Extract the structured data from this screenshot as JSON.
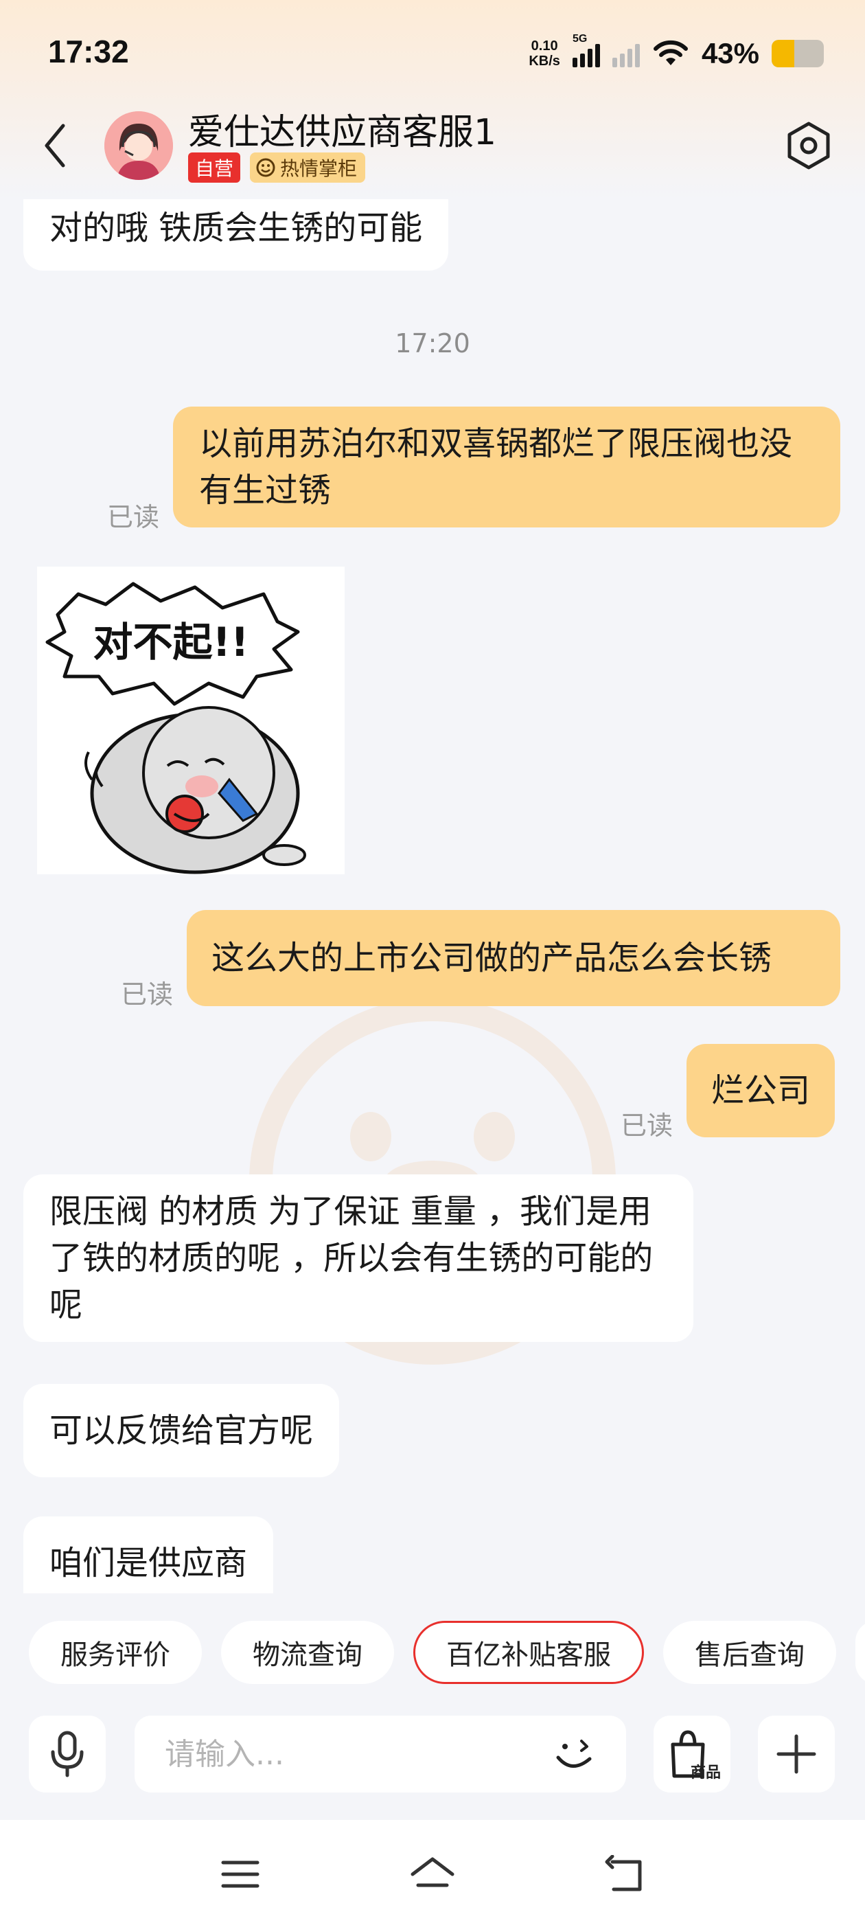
{
  "status_bar": {
    "time": "17:32",
    "net_speed_value": "0.10",
    "net_speed_unit": "KB/s",
    "network_type": "5G",
    "battery_percent": "43%",
    "battery_level": 0.43
  },
  "header": {
    "shop_name": "爱仕达供应商客服1",
    "badge_self_operated": "自营",
    "badge_keeper": "热情掌柜"
  },
  "messages": [
    {
      "side": "in",
      "text": "对的哦 铁质会生锈的可能"
    },
    {
      "type": "timestamp",
      "text": "17:20"
    },
    {
      "side": "out",
      "text": "以前用苏泊尔和双喜锅都烂了限压阀也没有生过锈",
      "read_label": "已读"
    },
    {
      "side": "in",
      "type": "sticker",
      "text": "对不起!!"
    },
    {
      "side": "out",
      "text": "这么大的上市公司做的产品怎么会长锈",
      "read_label": "已读"
    },
    {
      "side": "out",
      "text": "烂公司",
      "read_label": "已读"
    },
    {
      "side": "in",
      "text": "限压阀 的材质 为了保证 重量 ，我们是用了铁的材质的呢 ，所以会有生锈的可能的呢"
    },
    {
      "side": "in",
      "text": "可以反馈给官方呢"
    },
    {
      "side": "in",
      "text": "咱们是供应商"
    }
  ],
  "quick_replies": [
    "服务评价",
    "物流查询",
    "百亿补贴客服",
    "售后查询"
  ],
  "quick_reply_active": "百亿补贴客服",
  "input": {
    "placeholder": "请输入...",
    "goods_label": "商品"
  },
  "icons": {
    "back": "chevron-left-icon",
    "settings": "settings-icon",
    "mic": "mic-icon",
    "emoji": "emoji-icon",
    "goods": "shopping-bag-icon",
    "plus": "plus-icon",
    "menu": "menu-icon",
    "home": "home-icon",
    "back_nav": "back-nav-icon"
  },
  "colors": {
    "outgoing_bubble": "#fdd48a",
    "incoming_bubble": "#ffffff",
    "accent_red": "#e8302d",
    "background": "#f4f5f9"
  }
}
